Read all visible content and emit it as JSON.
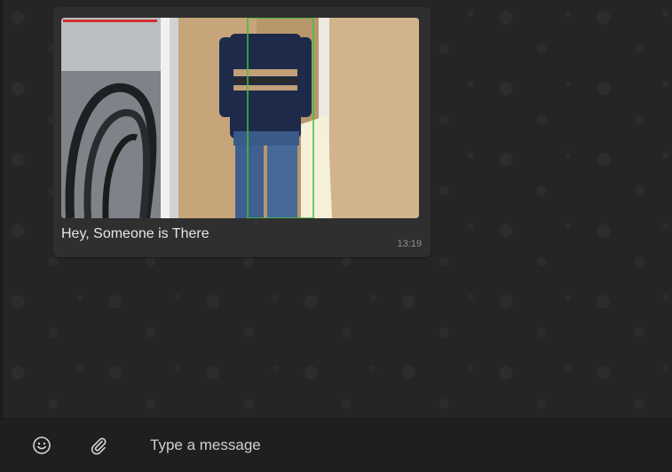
{
  "conversation": {
    "messages": [
      {
        "caption": "Hey, Someone is There",
        "time": "13:19",
        "image": "photo-person-standing-with-detection-box"
      }
    ]
  },
  "composer": {
    "placeholder": "Type a message",
    "emoji_icon": "smiley-icon",
    "attach_icon": "paperclip-icon"
  },
  "colors": {
    "chat_background": "#252525",
    "bubble": "#2f2f2f",
    "composer": "#1f1f1f",
    "detection_box": "#3cc23c"
  }
}
